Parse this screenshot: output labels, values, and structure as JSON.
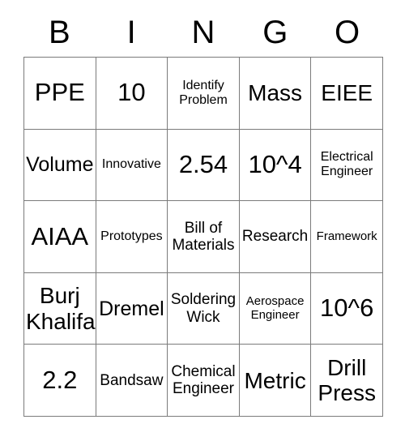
{
  "card": {
    "title": "BINGO",
    "headers": [
      "B",
      "I",
      "N",
      "G",
      "O"
    ],
    "border_color": "#7b7b7b",
    "background_color": "#ffffff",
    "text_color": "#000000",
    "rows": [
      [
        {
          "text": "PPE",
          "size": "fs-xl"
        },
        {
          "text": "10",
          "size": "fs-xl"
        },
        {
          "text": "Identify\nProblem",
          "size": "fs-xs"
        },
        {
          "text": "Mass",
          "size": "fs-lg"
        },
        {
          "text": "EIEE",
          "size": "fs-lg"
        }
      ],
      [
        {
          "text": "Volume",
          "size": "fs-md"
        },
        {
          "text": "Innovative",
          "size": "fs-xs"
        },
        {
          "text": "2.54",
          "size": "fs-xl"
        },
        {
          "text": "10^4",
          "size": "fs-xl"
        },
        {
          "text": "Electrical\nEngineer",
          "size": "fs-xs"
        }
      ],
      [
        {
          "text": "AIAA",
          "size": "fs-xl"
        },
        {
          "text": "Prototypes",
          "size": "fs-xs"
        },
        {
          "text": "Bill of\nMaterials",
          "size": "fs-sm"
        },
        {
          "text": "Research",
          "size": "fs-sm"
        },
        {
          "text": "Framework",
          "size": "fs-xxs"
        }
      ],
      [
        {
          "text": "Burj\nKhalifa",
          "size": "fs-lg"
        },
        {
          "text": "Dremel",
          "size": "fs-md"
        },
        {
          "text": "Soldering\nWick",
          "size": "fs-sm"
        },
        {
          "text": "Aerospace\nEngineer",
          "size": "fs-xxs"
        },
        {
          "text": "10^6",
          "size": "fs-xl"
        }
      ],
      [
        {
          "text": "2.2",
          "size": "fs-xl"
        },
        {
          "text": "Bandsaw",
          "size": "fs-sm"
        },
        {
          "text": "Chemical\nEngineer",
          "size": "fs-sm"
        },
        {
          "text": "Metric",
          "size": "fs-lg"
        },
        {
          "text": "Drill\nPress",
          "size": "fs-lg"
        }
      ]
    ]
  }
}
